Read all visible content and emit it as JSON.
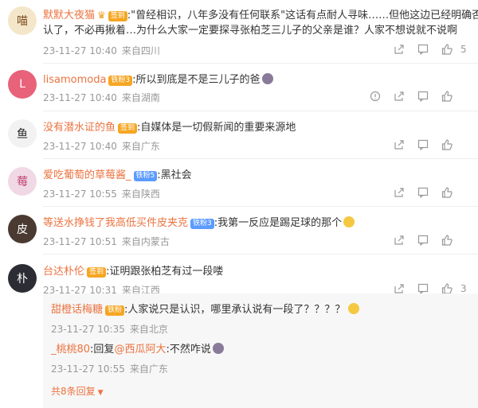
{
  "comments": [
    {
      "user": "默默大夜猫",
      "badge": "签到",
      "text": ":\"曾经相识，八年多没有任何联系\"这话有点耐人寻味……但他这边已经明确否认了，不必再揪着…为什么大家一定要探寻张柏芝三儿子的父亲是谁？人家不想说就不说啊",
      "text_line1": ":\"曾经相识，八年多没有任何联系\"这话有点耐人寻味……但他这边已经明确否",
      "text_line2": "认了，不必再揪着…为什么大家一定要探寻张柏芝三儿子的父亲是谁？人家不想说就不说啊",
      "time": "23-11-27 10:40",
      "location": "来自四川",
      "likes": "5"
    },
    {
      "user": "lisamomoda",
      "badge": "铁粉3",
      "text": ":所以到底是不是三儿子的爸",
      "time": "23-11-27 10:40",
      "location": "来自湖南",
      "likes": ""
    },
    {
      "user": "没有潜水证的鱼",
      "badge": "签到",
      "text": ":自媒体是一切假新闻的重要来源地",
      "time": "23-11-27 10:40",
      "location": "来自广东",
      "likes": ""
    },
    {
      "user": "爱吃葡萄的草莓酱_",
      "badge": "铁粉5",
      "text": ":黑社会",
      "time": "23-11-27 10:55",
      "location": "来自陕西",
      "likes": ""
    },
    {
      "user": "等送水挣钱了我高低买件皮夹克",
      "badge": "铁粉3",
      "text": ":我第一反应是踢足球的那个",
      "time": "23-11-27 10:51",
      "location": "来自内蒙古",
      "likes": ""
    },
    {
      "user": "台达朴伦",
      "badge": "签到",
      "text": ":证明跟张柏芝有过一段喽",
      "time": "23-11-27 10:31",
      "location": "来自江西",
      "likes": "3"
    }
  ],
  "replies": [
    {
      "user": "甜橙话梅糖",
      "badge": "铁粉",
      "text": ":人家说只是认识，哪里承认说有一段了？？？？",
      "time": "23-11-27 10:35",
      "location": "来自北京"
    },
    {
      "user": "_桃桃80",
      "text_prefix": ":回复",
      "mention": "@西瓜阿大",
      "text": ":不然咋说",
      "time": "23-11-27 10:55",
      "location": "来自广东"
    }
  ],
  "more_replies": "共8条回复",
  "colors": {
    "username": "#eb7340",
    "meta": "#999999",
    "reply_bg": "#f7f7f7"
  }
}
